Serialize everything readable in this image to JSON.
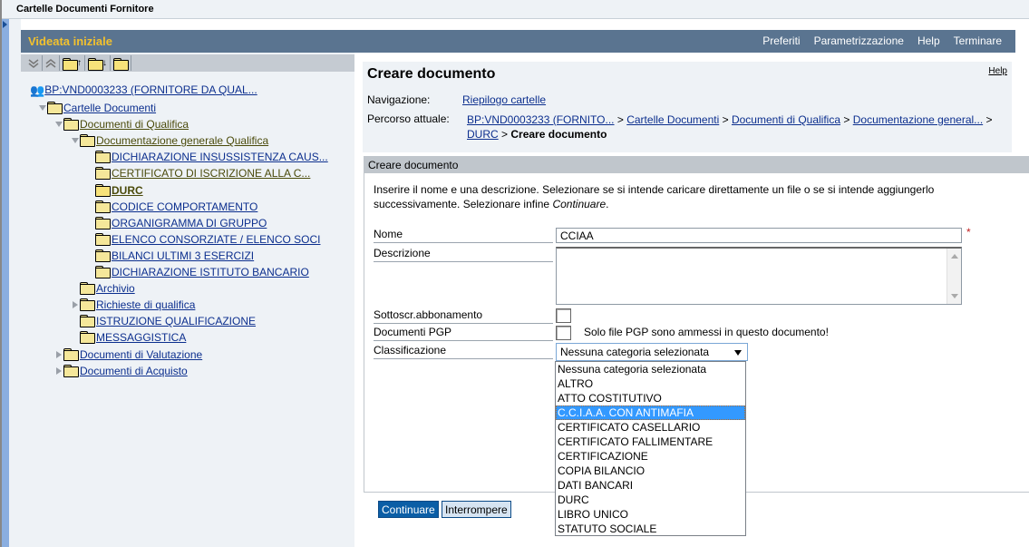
{
  "window": {
    "title": "Cartelle Documenti Fornitore"
  },
  "header": {
    "title": "Videata iniziale",
    "menu": [
      "Preferiti",
      "Parametrizzazione",
      "Help",
      "Terminare"
    ]
  },
  "tree": {
    "toolbar": [
      "expand-all-icon",
      "collapse-all-icon",
      "folder-up-icon",
      "folder-down-icon",
      "folder-search-icon"
    ],
    "root": "BP:VND0003233 (FORNITORE DA QUAL...",
    "nodes": [
      {
        "label": "Cartelle Documenti",
        "level": 1,
        "state": "open"
      },
      {
        "label": "Documenti di Qualifica",
        "level": 2,
        "state": "open"
      },
      {
        "label": "Documentazione generale Qualifica",
        "level": 3,
        "state": "open"
      },
      {
        "label": "DICHIARAZIONE INSUSSISTENZA CAUS...",
        "level": 4,
        "state": "leaf"
      },
      {
        "label": "CERTIFICATO DI ISCRIZIONE ALLA C...",
        "level": 4,
        "state": "leaf"
      },
      {
        "label": "DURC",
        "level": 4,
        "state": "selected"
      },
      {
        "label": "CODICE COMPORTAMENTO",
        "level": 4,
        "state": "leaf"
      },
      {
        "label": "ORGANIGRAMMA DI GRUPPO",
        "level": 4,
        "state": "leaf"
      },
      {
        "label": "ELENCO CONSORZIATE / ELENCO SOCI",
        "level": 4,
        "state": "leaf"
      },
      {
        "label": "BILANCI ULTIMI 3 ESERCIZI",
        "level": 4,
        "state": "leaf"
      },
      {
        "label": "DICHIARAZIONE ISTITUTO BANCARIO",
        "level": 4,
        "state": "leaf"
      },
      {
        "label": "Archivio",
        "level": 3,
        "state": "leaf"
      },
      {
        "label": "Richieste di qualifica",
        "level": 3,
        "state": "closed"
      },
      {
        "label": "ISTRUZIONE QUALIFICAZIONE",
        "level": 3,
        "state": "leaf"
      },
      {
        "label": "MESSAGGISTICA",
        "level": 3,
        "state": "leaf"
      },
      {
        "label": "Documenti di Valutazione",
        "level": 2,
        "state": "closed"
      },
      {
        "label": "Documenti di Acquisto",
        "level": 2,
        "state": "closed"
      }
    ]
  },
  "page": {
    "title": "Creare documento",
    "help": "Help",
    "nav_label": "Navigazione:",
    "nav_link": "Riepilogo cartelle",
    "path_label": "Percorso attuale:",
    "path": [
      "BP:VND0003233 (FORNITO...",
      "Cartelle Documenti",
      "Documenti di Qualifica",
      "Documentazione general...",
      "DURC"
    ],
    "path_current": "Creare documento",
    "separator": ">"
  },
  "form": {
    "section_title": "Creare documento",
    "intro": "Inserire il nome e una descrizione. Selezionare se si intende caricare direttamente un file o se si intende aggiungerlo successivamente. Selezionare infine ",
    "intro_em": "Continuare",
    "intro_end": ".",
    "fields": {
      "nome_label": "Nome",
      "nome_value": "CCIAA",
      "required_mark": "*",
      "descrizione_label": "Descrizione",
      "descrizione_value": "",
      "sottoscr_label": "Sottoscr.abbonamento",
      "sottoscr_checked": false,
      "pgp_label": "Documenti PGP",
      "pgp_checked": false,
      "pgp_note": "Solo file PGP sono ammessi in questo documento!",
      "classificazione_label": "Classificazione",
      "classificazione_value": "Nessuna categoria selezionata"
    },
    "buttons": {
      "continue": "Continuare",
      "cancel": "Interrompere"
    }
  },
  "dropdown": {
    "options": [
      "Nessuna categoria selezionata",
      "ALTRO",
      "ATTO COSTITUTIVO",
      "C.C.I.A.A. CON ANTIMAFIA",
      "CERTIFICATO CASELLARIO",
      "CERTIFICATO FALLIMENTARE",
      "CERTIFICAZIONE",
      "COPIA BILANCIO",
      "DATI BANCARI",
      "DURC",
      "LIBRO UNICO",
      "STATUTO SOCIALE"
    ],
    "highlighted_index": 3
  }
}
